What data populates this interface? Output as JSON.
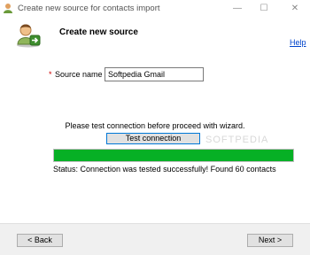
{
  "window": {
    "title": "Create new source for contacts import",
    "controls": {
      "minimize": "—",
      "maximize": "☐",
      "close": "✕"
    }
  },
  "header": {
    "title": "Create new source",
    "icon": "user-import-icon",
    "help_label": "Help"
  },
  "form": {
    "required_marker": "*",
    "source_name_label": "Source name",
    "source_name_value": "Softpedia Gmail"
  },
  "connection": {
    "instruction": "Please test connection before proceed with wizard.",
    "test_button_label": "Test connection",
    "watermark": "SOFTPEDIA",
    "progress_fraction": 1.0,
    "progress_color": "#06b025",
    "status_text": "Status: Connection was tested successfully! Found 60 contacts"
  },
  "footer": {
    "back_label": "< Back",
    "next_label": "Next >"
  }
}
